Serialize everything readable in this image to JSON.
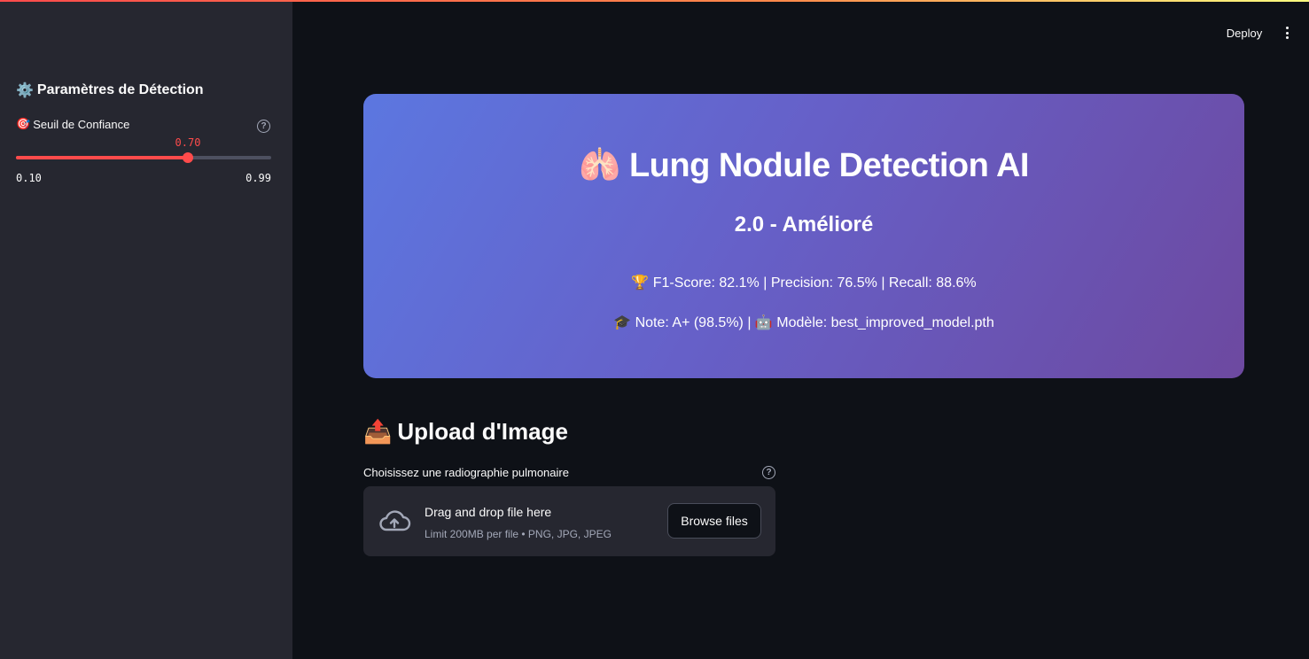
{
  "header": {
    "deploy_label": "Deploy",
    "menu_icon": "vertical-ellipsis-icon"
  },
  "sidebar": {
    "title_icon": "⚙️",
    "title": "Paramètres de Détection",
    "slider": {
      "icon": "🎯",
      "label": "Seuil de Confiance",
      "value": "0.70",
      "min": "0.10",
      "max": "0.99",
      "fraction": 0.674
    }
  },
  "hero": {
    "title_icon": "🫁",
    "title": "Lung Nodule Detection AI",
    "subtitle": "2.0 - Amélioré",
    "metrics": "🏆 F1-Score: 82.1% | Precision: 76.5% | Recall: 88.6%",
    "model": "🎓 Note: A+ (98.5%) | 🤖 Modèle: best_improved_model.pth"
  },
  "upload": {
    "heading_icon": "📤",
    "heading": "Upload d'Image",
    "label": "Choisissez une radiographie pulmonaire",
    "drop_title": "Drag and drop file here",
    "drop_limit": "Limit 200MB per file • PNG, JPG, JPEG",
    "browse_label": "Browse files"
  },
  "colors": {
    "accent": "#ff4b4b",
    "background": "#0e1117",
    "sidebar": "#262730",
    "hero_start": "#5c77e0",
    "hero_end": "#6d49a0"
  }
}
